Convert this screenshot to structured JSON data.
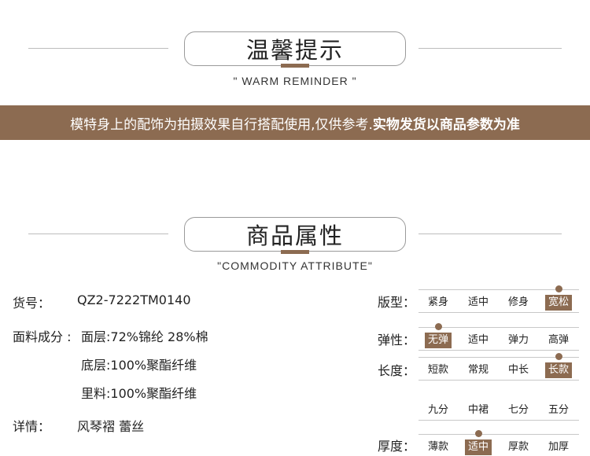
{
  "reminder": {
    "title": "温馨提示",
    "subtitle": "\" WARM REMINDER \"",
    "banner_text": "模特身上的配饰为拍摄效果自行搭配使用,仅供参考.",
    "banner_strong": "实物发货以商品参数为准"
  },
  "attributes_section": {
    "title": "商品属性",
    "subtitle": "\"COMMODITY ATTRIBUTE\""
  },
  "product": {
    "sku_label": "货号：",
    "sku_value": "QZ2-7222TM0140",
    "fabric_label": "面料成分 :",
    "fabric_lines": [
      "面层:72%锦纶 28%棉",
      "底层:100%聚酯纤维",
      "里料:100%聚酯纤维"
    ],
    "details_label": "详情：",
    "details_value": "风琴褶 蕾丝"
  },
  "attributes": {
    "fit": {
      "label": "版型：",
      "options": [
        "紧身",
        "适中",
        "修身",
        "宽松"
      ],
      "selected": 3
    },
    "elasticity": {
      "label": "弹性：",
      "options": [
        "无弹",
        "适中",
        "弹力",
        "高弹"
      ],
      "selected": 0
    },
    "length": {
      "label": "长度：",
      "options": [
        "短款",
        "常规",
        "中长",
        "长款"
      ],
      "options_row2": [
        "九分",
        "中裙",
        "七分",
        "五分"
      ],
      "selected": 3
    },
    "thickness": {
      "label": "厚度：",
      "options": [
        "薄款",
        "适中",
        "厚款",
        "加厚"
      ],
      "selected": 1
    }
  },
  "colors": {
    "accent": "#8c6b51",
    "line": "#c8c8c8"
  }
}
